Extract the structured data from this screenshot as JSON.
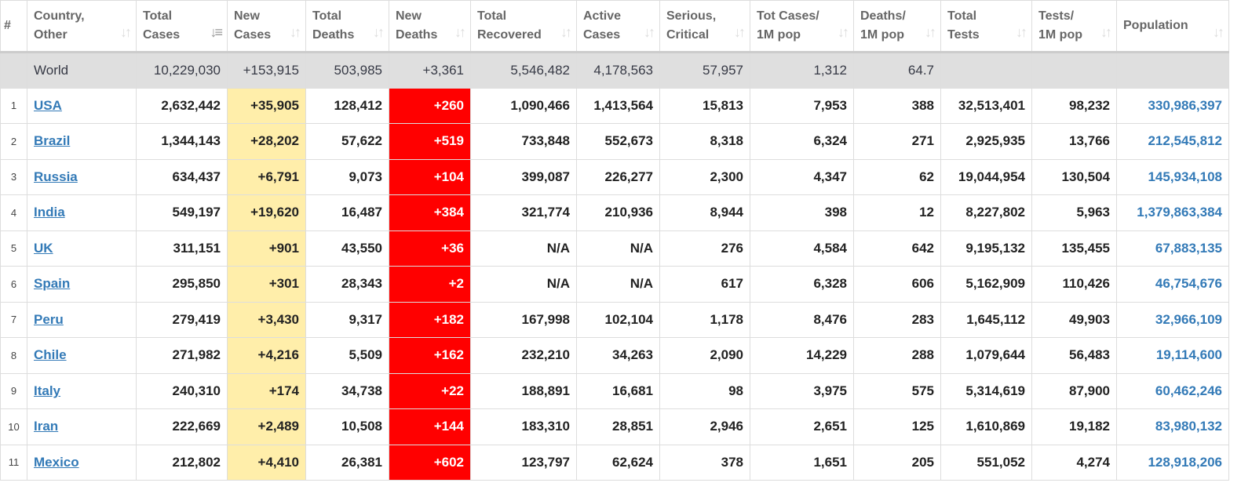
{
  "columns": [
    {
      "label": "#",
      "sort": false
    },
    {
      "label": "Country,\nOther",
      "sort": true
    },
    {
      "label": "Total\nCases",
      "sort": true,
      "active": true
    },
    {
      "label": "New\nCases",
      "sort": true
    },
    {
      "label": "Total\nDeaths",
      "sort": true
    },
    {
      "label": "New\nDeaths",
      "sort": true
    },
    {
      "label": "Total\nRecovered",
      "sort": true
    },
    {
      "label": "Active\nCases",
      "sort": true
    },
    {
      "label": "Serious,\nCritical",
      "sort": true
    },
    {
      "label": "Tot Cases/\n1M pop",
      "sort": true
    },
    {
      "label": "Deaths/\n1M pop",
      "sort": true
    },
    {
      "label": "Total\nTests",
      "sort": true
    },
    {
      "label": "Tests/\n1M pop",
      "sort": true
    },
    {
      "label": "Population",
      "sort": true
    }
  ],
  "icons": {
    "sort": "sort-icon",
    "sort_glyph": "↓↑",
    "sort_active_glyph": "↓≡"
  },
  "world": [
    "",
    "World",
    "10,229,030",
    "+153,915",
    "503,985",
    "+3,361",
    "5,546,482",
    "4,178,563",
    "57,957",
    "1,312",
    "64.7",
    "",
    "",
    ""
  ],
  "rows": [
    [
      "1",
      "USA",
      "2,632,442",
      "+35,905",
      "128,412",
      "+260",
      "1,090,466",
      "1,413,564",
      "15,813",
      "7,953",
      "388",
      "32,513,401",
      "98,232",
      "330,986,397"
    ],
    [
      "2",
      "Brazil",
      "1,344,143",
      "+28,202",
      "57,622",
      "+519",
      "733,848",
      "552,673",
      "8,318",
      "6,324",
      "271",
      "2,925,935",
      "13,766",
      "212,545,812"
    ],
    [
      "3",
      "Russia",
      "634,437",
      "+6,791",
      "9,073",
      "+104",
      "399,087",
      "226,277",
      "2,300",
      "4,347",
      "62",
      "19,044,954",
      "130,504",
      "145,934,108"
    ],
    [
      "4",
      "India",
      "549,197",
      "+19,620",
      "16,487",
      "+384",
      "321,774",
      "210,936",
      "8,944",
      "398",
      "12",
      "8,227,802",
      "5,963",
      "1,379,863,384"
    ],
    [
      "5",
      "UK",
      "311,151",
      "+901",
      "43,550",
      "+36",
      "N/A",
      "N/A",
      "276",
      "4,584",
      "642",
      "9,195,132",
      "135,455",
      "67,883,135"
    ],
    [
      "6",
      "Spain",
      "295,850",
      "+301",
      "28,343",
      "+2",
      "N/A",
      "N/A",
      "617",
      "6,328",
      "606",
      "5,162,909",
      "110,426",
      "46,754,676"
    ],
    [
      "7",
      "Peru",
      "279,419",
      "+3,430",
      "9,317",
      "+182",
      "167,998",
      "102,104",
      "1,178",
      "8,476",
      "283",
      "1,645,112",
      "49,903",
      "32,966,109"
    ],
    [
      "8",
      "Chile",
      "271,982",
      "+4,216",
      "5,509",
      "+162",
      "232,210",
      "34,263",
      "2,090",
      "14,229",
      "288",
      "1,079,644",
      "56,483",
      "19,114,600"
    ],
    [
      "9",
      "Italy",
      "240,310",
      "+174",
      "34,738",
      "+22",
      "188,891",
      "16,681",
      "98",
      "3,975",
      "575",
      "5,314,619",
      "87,900",
      "60,462,246"
    ],
    [
      "10",
      "Iran",
      "222,669",
      "+2,489",
      "10,508",
      "+144",
      "183,310",
      "28,851",
      "2,946",
      "2,651",
      "125",
      "1,610,869",
      "19,182",
      "83,980,132"
    ],
    [
      "11",
      "Mexico",
      "212,802",
      "+4,410",
      "26,381",
      "+602",
      "123,797",
      "62,624",
      "378",
      "1,651",
      "205",
      "551,052",
      "4,274",
      "128,918,206"
    ]
  ],
  "colors": {
    "new_cases_bg": "#ffeeaa",
    "new_deaths_bg": "#ff0000",
    "world_bg": "#dfdfdf",
    "link": "#337ab7"
  }
}
